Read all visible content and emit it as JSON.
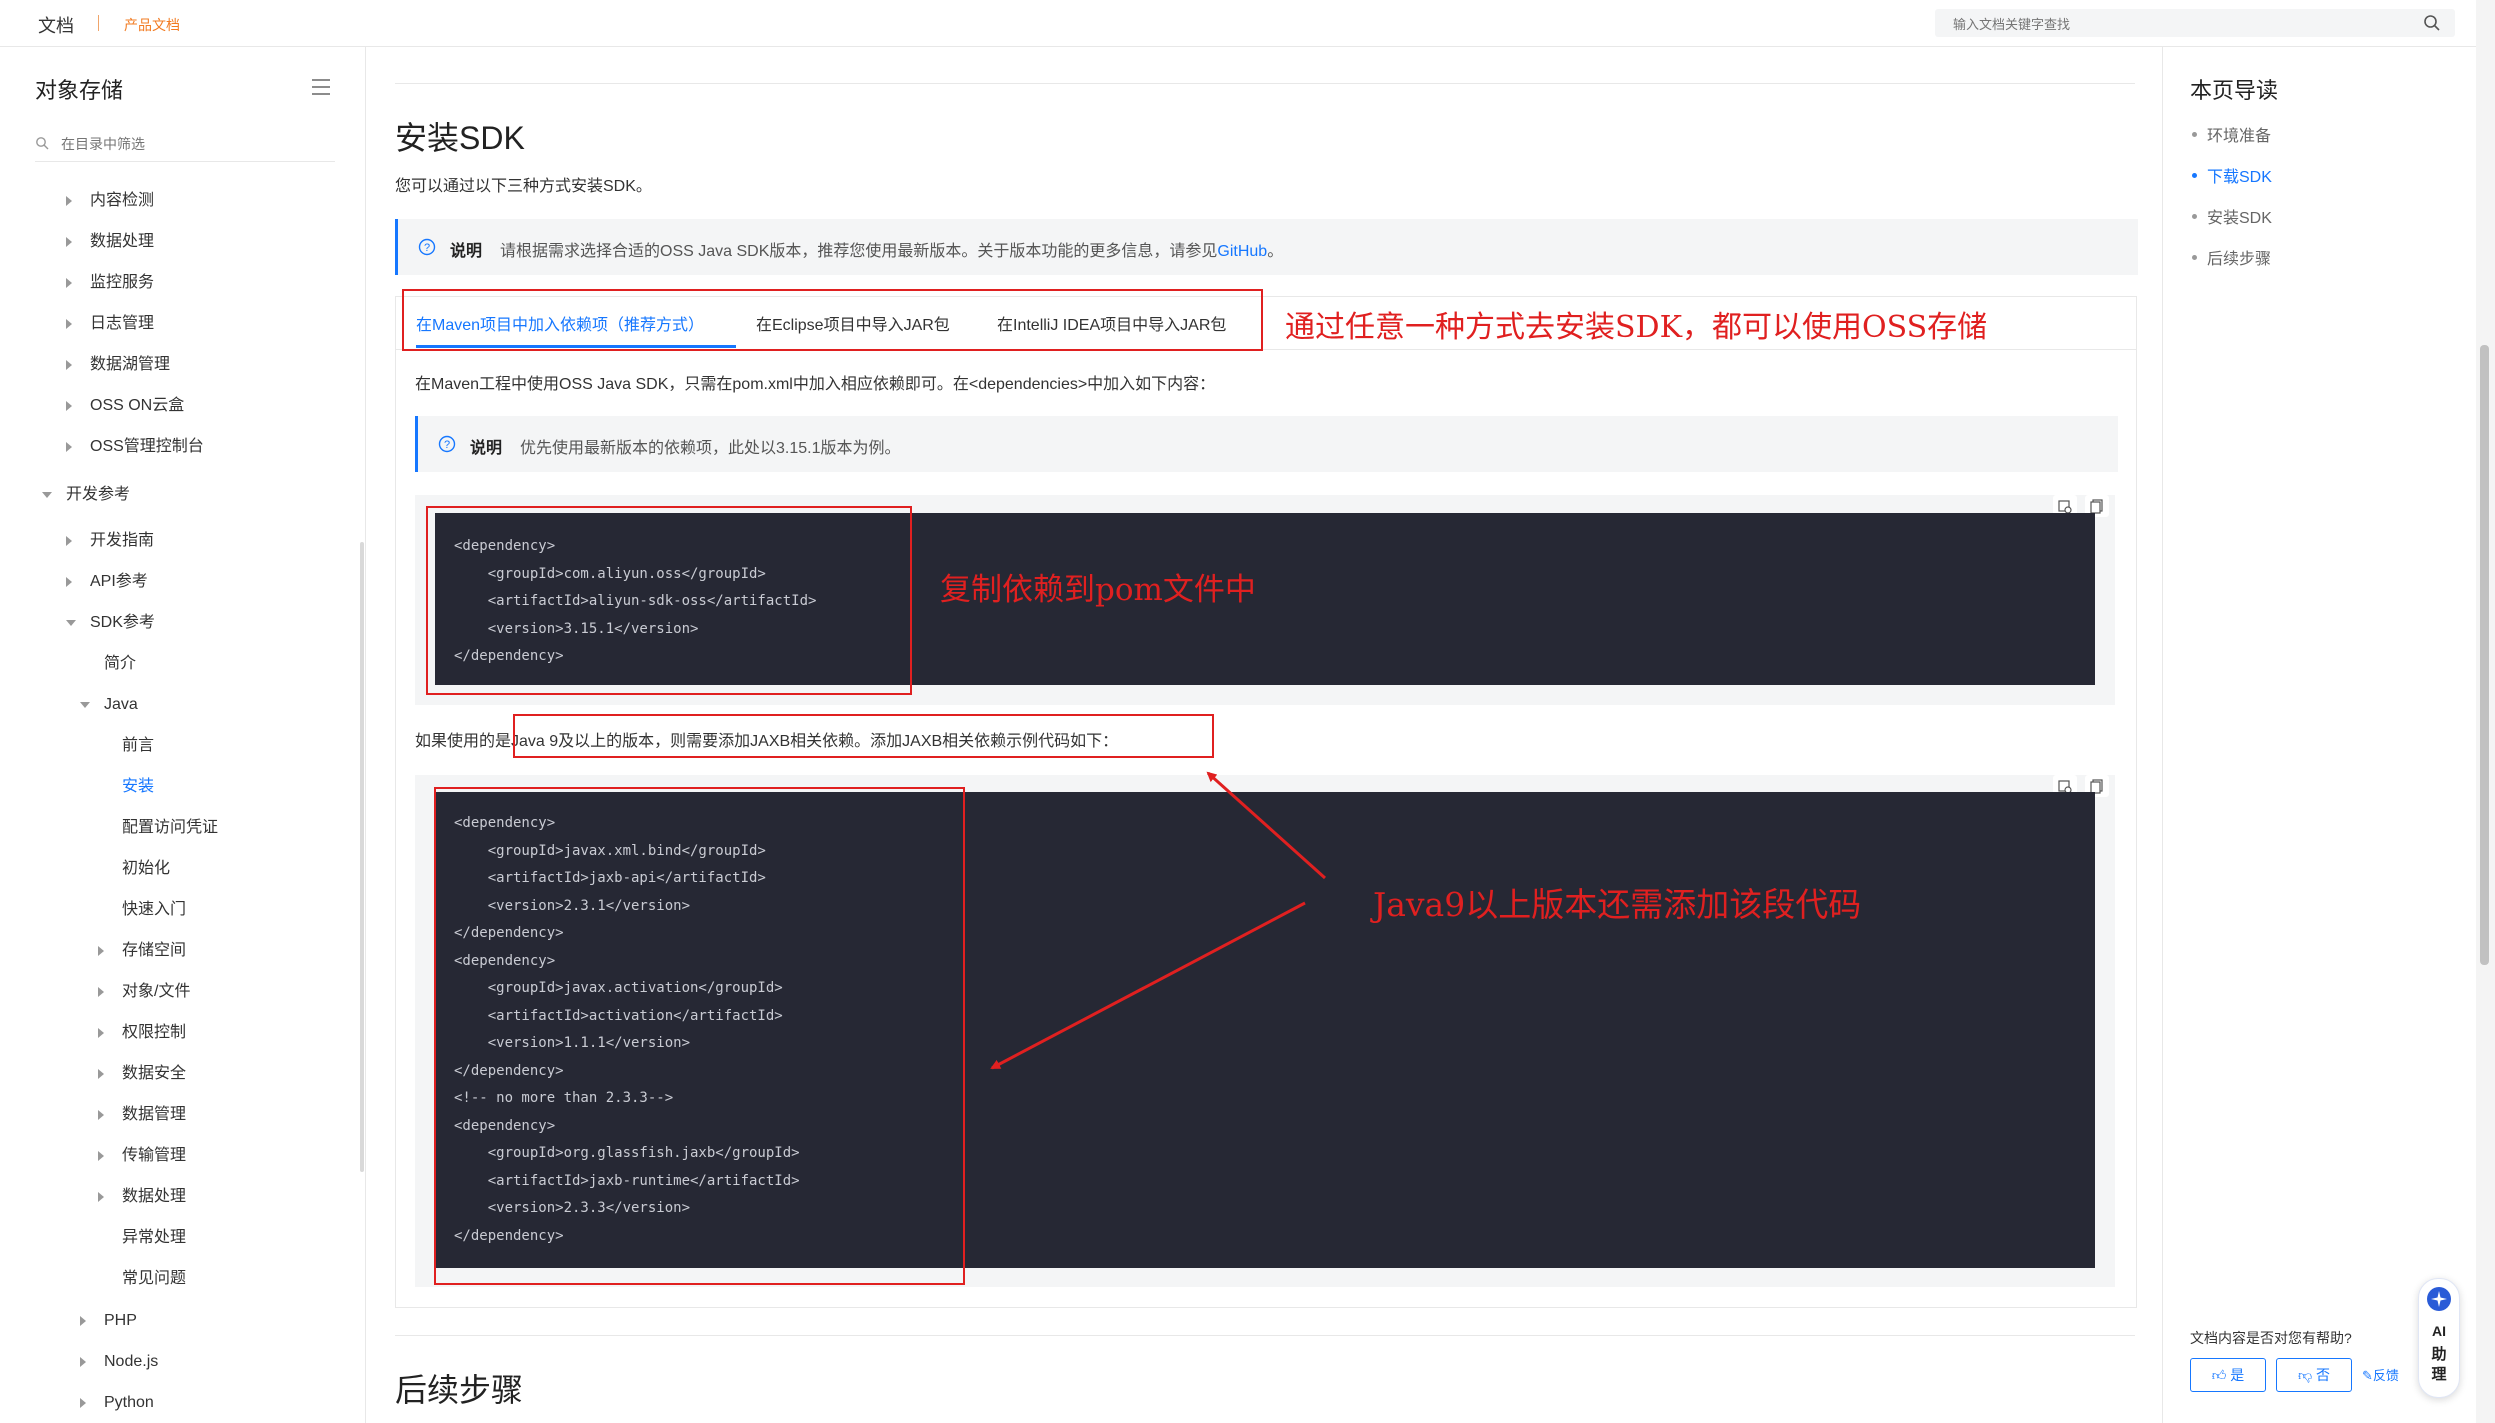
{
  "topbar": {
    "brand": "文档",
    "product": "产品文档",
    "search_placeholder": "输入文档关键字查找"
  },
  "sidebar": {
    "title": "对象存储",
    "filter_placeholder": "在目录中筛选",
    "items": [
      {
        "label": "内容检测",
        "arrow": "right",
        "indent": 1
      },
      {
        "label": "数据处理",
        "arrow": "right",
        "indent": 1
      },
      {
        "label": "监控服务",
        "arrow": "right",
        "indent": 1
      },
      {
        "label": "日志管理",
        "arrow": "right",
        "indent": 1
      },
      {
        "label": "数据湖管理",
        "arrow": "right",
        "indent": 1
      },
      {
        "label": "OSS ON云盒",
        "arrow": "right",
        "indent": 1
      },
      {
        "label": "OSS管理控制台",
        "arrow": "right",
        "indent": 1
      },
      {
        "label": "开发参考",
        "arrow": "down",
        "indent": 0
      },
      {
        "label": "开发指南",
        "arrow": "right",
        "indent": 1
      },
      {
        "label": "API参考",
        "arrow": "right",
        "indent": 1
      },
      {
        "label": "SDK参考",
        "arrow": "down",
        "indent": 1
      },
      {
        "label": "简介",
        "arrow": "",
        "indent": 2
      },
      {
        "label": "Java",
        "arrow": "down",
        "indent": 2
      },
      {
        "label": "前言",
        "arrow": "",
        "indent": 3
      },
      {
        "label": "安装",
        "arrow": "",
        "indent": 3,
        "active": true
      },
      {
        "label": "配置访问凭证",
        "arrow": "",
        "indent": 3
      },
      {
        "label": "初始化",
        "arrow": "",
        "indent": 3
      },
      {
        "label": "快速入门",
        "arrow": "",
        "indent": 3
      },
      {
        "label": "存储空间",
        "arrow": "right",
        "indent": 3
      },
      {
        "label": "对象/文件",
        "arrow": "right",
        "indent": 3
      },
      {
        "label": "权限控制",
        "arrow": "right",
        "indent": 3
      },
      {
        "label": "数据安全",
        "arrow": "right",
        "indent": 3
      },
      {
        "label": "数据管理",
        "arrow": "right",
        "indent": 3
      },
      {
        "label": "传输管理",
        "arrow": "right",
        "indent": 3
      },
      {
        "label": "数据处理",
        "arrow": "right",
        "indent": 3
      },
      {
        "label": "异常处理",
        "arrow": "",
        "indent": 3
      },
      {
        "label": "常见问题",
        "arrow": "",
        "indent": 3
      },
      {
        "label": "PHP",
        "arrow": "right",
        "indent": 2
      },
      {
        "label": "Node.js",
        "arrow": "right",
        "indent": 2
      },
      {
        "label": "Python",
        "arrow": "right",
        "indent": 2
      }
    ]
  },
  "main": {
    "heading": "安装SDK",
    "intro": "您可以通过以下三种方式安装SDK。",
    "note1": {
      "label": "说明",
      "text": "请根据需求选择合适的OSS Java SDK版本，推荐您使用最新版本。关于版本功能的更多信息，请参见",
      "link": "GitHub",
      "tail": "。"
    },
    "tabs": [
      {
        "label": "在Maven项目中加入依赖项（推荐方式）",
        "active": true
      },
      {
        "label": "在Eclipse项目中导入JAR包"
      },
      {
        "label": "在IntelliJ IDEA项目中导入JAR包"
      }
    ],
    "maven_para": "在Maven工程中使用OSS Java SDK，只需在pom.xml中加入相应依赖即可。在<dependencies>中加入如下内容：",
    "note2": {
      "label": "说明",
      "text": "优先使用最新版本的依赖项，此处以3.15.1版本为例。"
    },
    "code1": "<dependency>\n    <groupId>com.aliyun.oss</groupId>\n    <artifactId>aliyun-sdk-oss</artifactId>\n    <version>3.15.1</version>\n</dependency>",
    "java9_para": "如果使用的是Java 9及以上的版本，则需要添加JAXB相关依赖。添加JAXB相关依赖示例代码如下：",
    "code2": "<dependency>\n    <groupId>javax.xml.bind</groupId>\n    <artifactId>jaxb-api</artifactId>\n    <version>2.3.1</version>\n</dependency>\n<dependency>\n    <groupId>javax.activation</groupId>\n    <artifactId>activation</artifactId>\n    <version>1.1.1</version>\n</dependency>\n<!-- no more than 2.3.3-->\n<dependency>\n    <groupId>org.glassfish.jaxb</groupId>\n    <artifactId>jaxb-runtime</artifactId>\n    <version>2.3.3</version>\n</dependency>",
    "next_heading": "后续步骤"
  },
  "toc": {
    "title": "本页导读",
    "items": [
      {
        "label": "环境准备"
      },
      {
        "label": "下载SDK",
        "active": true
      },
      {
        "label": "安装SDK"
      },
      {
        "label": "后续步骤"
      }
    ]
  },
  "feedback": {
    "question": "文档内容是否对您有帮助?",
    "yes": "是",
    "no": "否",
    "report": "反馈"
  },
  "ai_assistant": {
    "line1": "AI",
    "line2": "助",
    "line3": "理"
  },
  "annotations": {
    "tabs_note": "通过任意一种方式去安装SDK，都可以使用OSS存储",
    "copy_note": "复制依赖到pom文件中",
    "java9_note": "Java9以上版本还需添加该段代码",
    "color": "#e02020"
  },
  "colors": {
    "accent": "#1677ff",
    "brand": "#f27b22",
    "code_bg": "#262834"
  }
}
